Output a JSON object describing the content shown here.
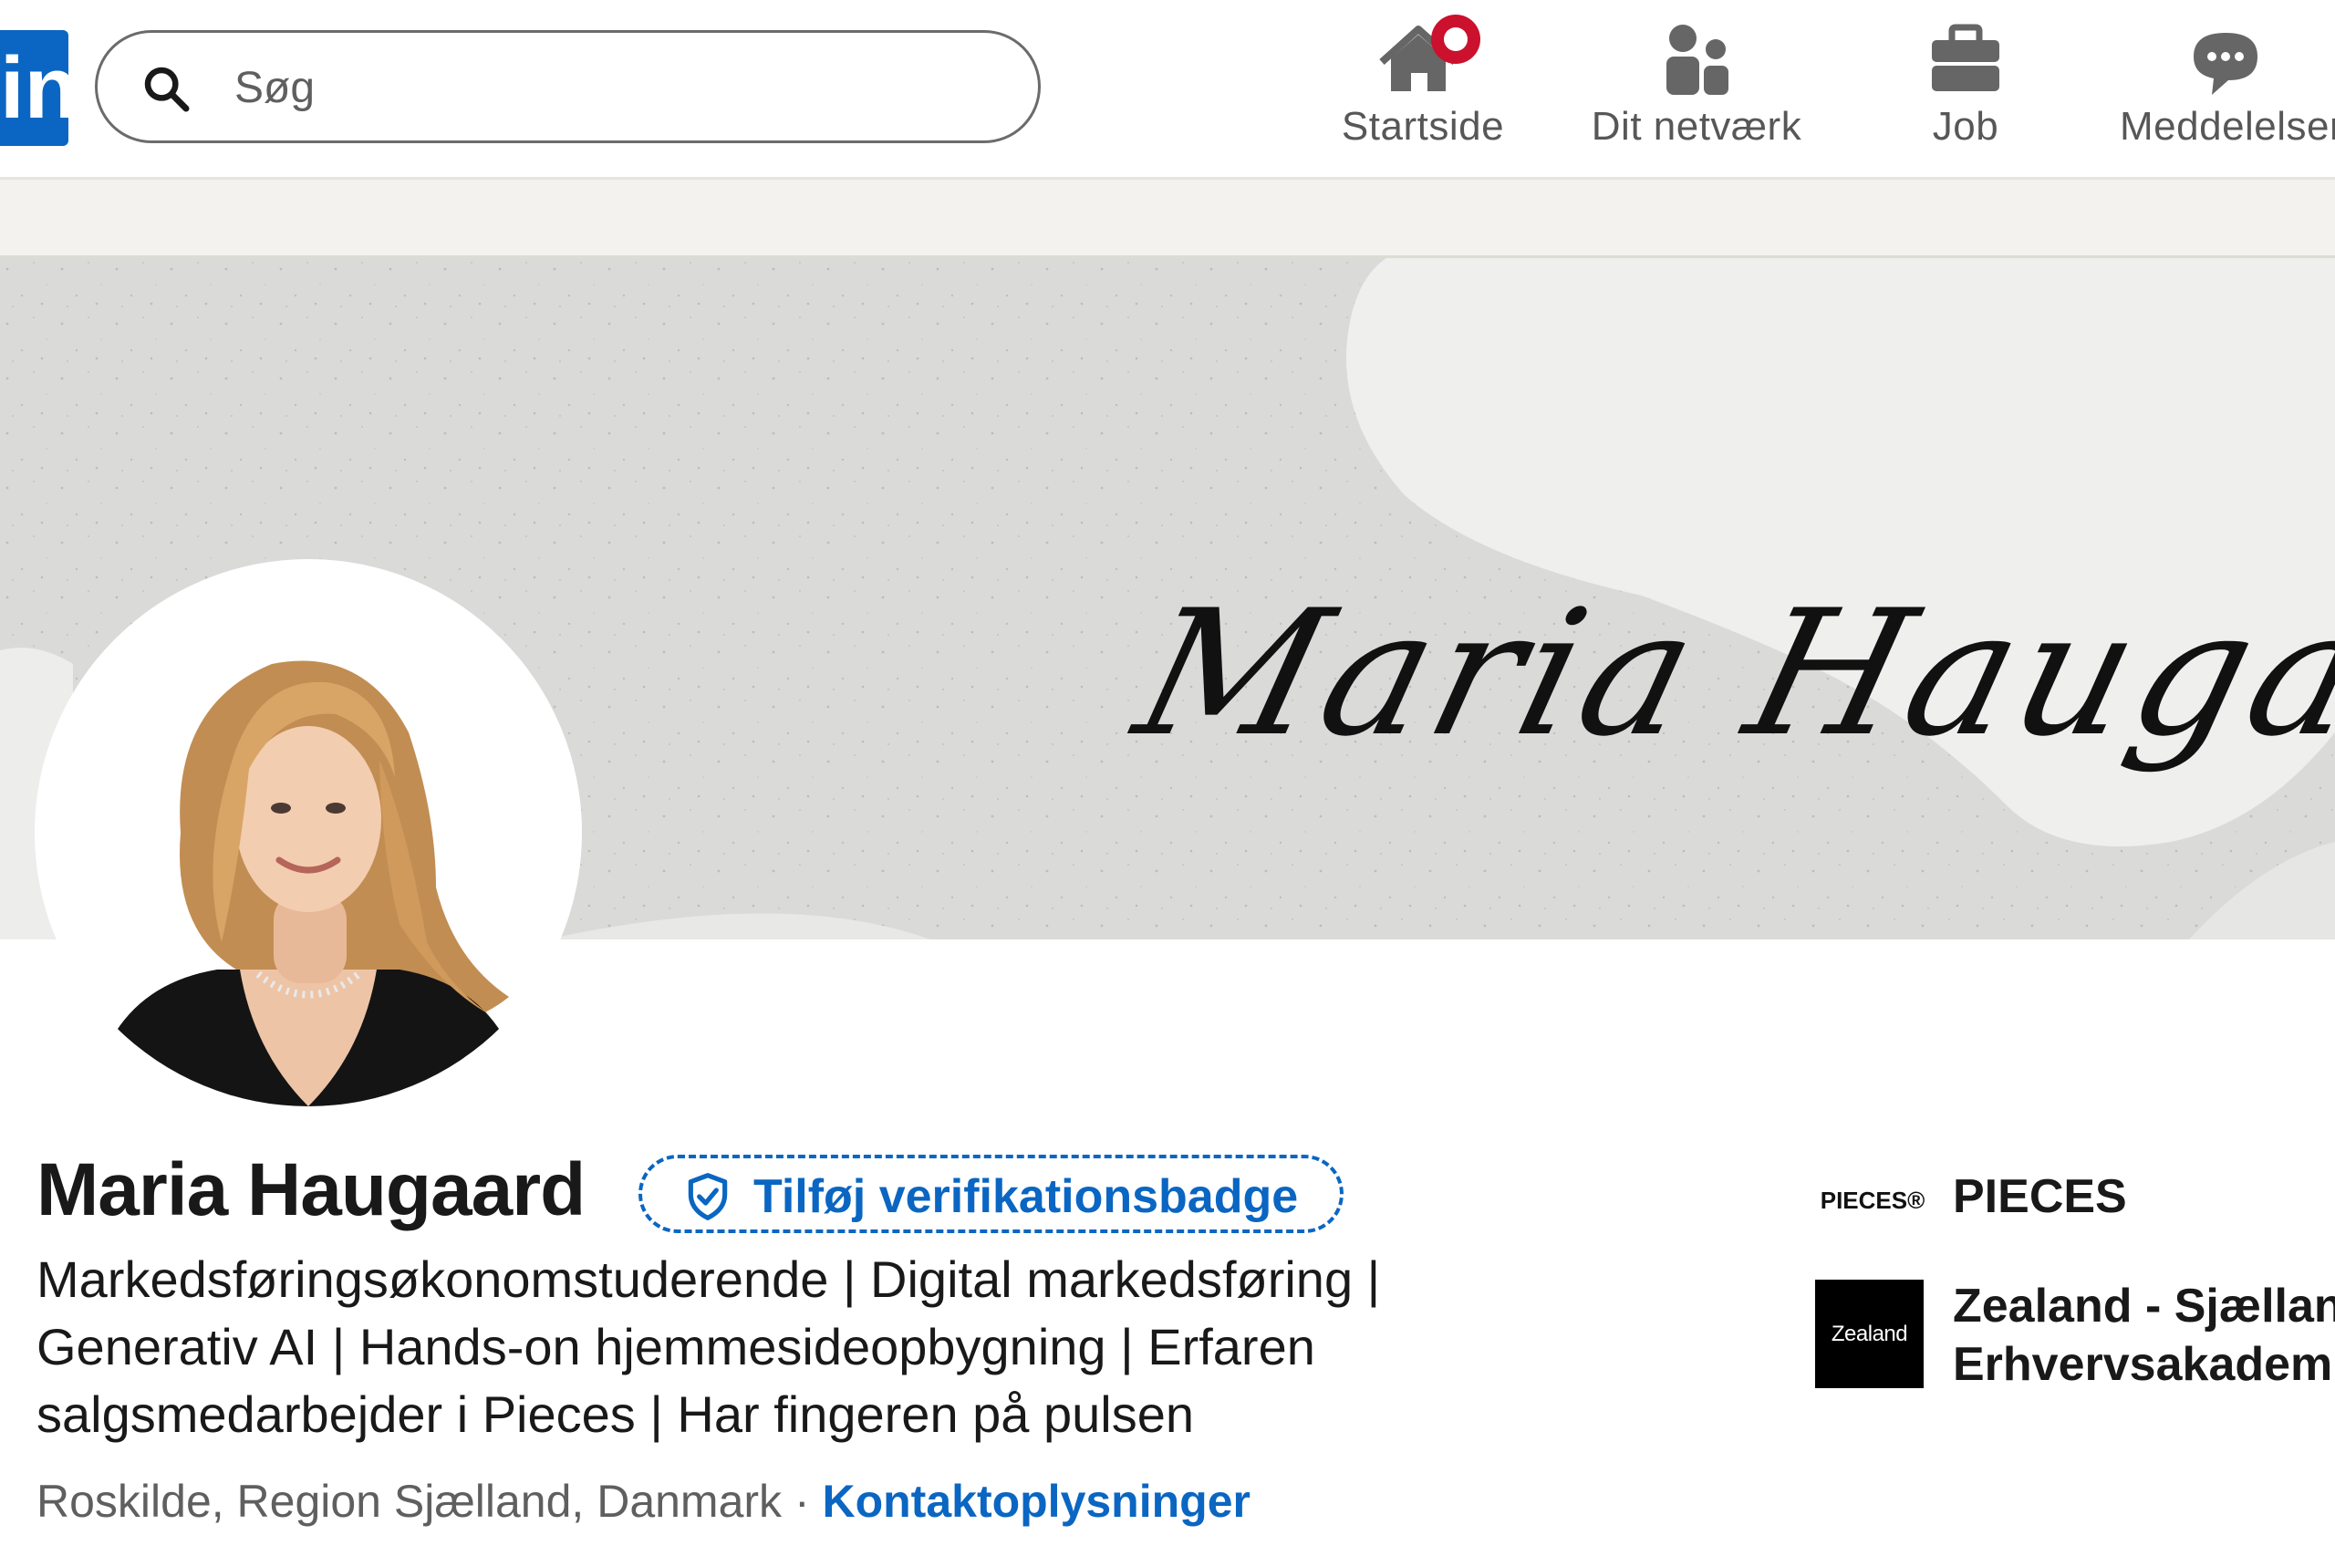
{
  "nav": {
    "logo_text": "in",
    "search_placeholder": "Søg",
    "items": [
      {
        "label": "Startside",
        "icon": "home-icon"
      },
      {
        "label": "Dit netværk",
        "icon": "network-icon"
      },
      {
        "label": "Job",
        "icon": "briefcase-icon"
      },
      {
        "label": "Meddelelser",
        "icon": "messaging-icon"
      }
    ]
  },
  "banner": {
    "signature_text": "Maria Haugaard"
  },
  "profile": {
    "name": "Maria Haugaard",
    "verify_label": "Tilføj verifikationsbadge",
    "headline": "Markedsføringsøkonomstuderende | Digital markedsføring | Generativ AI | Hands-on hjemmesideopbygning | Erfaren salgsmedarbejder i Pieces | Har fingeren på pulsen",
    "location": "Roskilde, Region Sjælland, Danmark",
    "separator": " · ",
    "contact_label": "Kontaktoplysninger"
  },
  "experience": [
    {
      "logo_text": "PIECES®",
      "name": "PIECES"
    },
    {
      "logo_text": "Zealand",
      "name_line1": "Zealand - Sjællands",
      "name_line2": "Erhvervsakademi"
    }
  ],
  "colors": {
    "brand": "#0a66c2",
    "notification": "#cb112d",
    "text_primary": "#191919",
    "text_secondary": "#5f5f5f"
  }
}
